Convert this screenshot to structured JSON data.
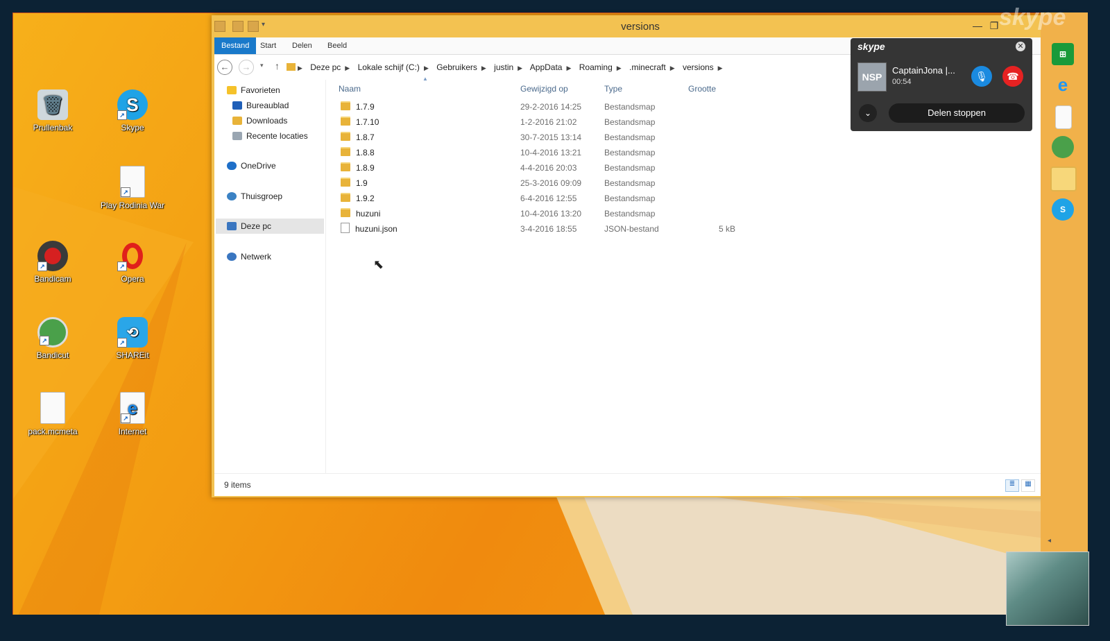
{
  "desktop": {
    "icons": [
      {
        "label": "Prullenbak"
      },
      {
        "label": "Skype"
      },
      {
        "label": "Play Rodinia War"
      },
      {
        "label": "Bandicam"
      },
      {
        "label": "Opera"
      },
      {
        "label": "Bandicut"
      },
      {
        "label": "SHAREit"
      },
      {
        "label": "pack.mcmeta"
      },
      {
        "label": "Internet"
      }
    ]
  },
  "explorer": {
    "title": "versions",
    "ribbon_tabs": [
      "Bestand",
      "Start",
      "Delen",
      "Beeld"
    ],
    "breadcrumb": [
      "Deze pc",
      "Lokale schijf (C:)",
      "Gebruikers",
      "justin",
      "AppData",
      "Roaming",
      ".minecraft",
      "versions"
    ],
    "nav": {
      "favorites": "Favorieten",
      "desktop": "Bureaublad",
      "downloads": "Downloads",
      "recent": "Recente locaties",
      "onedrive": "OneDrive",
      "homegroup": "Thuisgroep",
      "thispc": "Deze pc",
      "network": "Netwerk"
    },
    "columns": {
      "name": "Naam",
      "modified": "Gewijzigd op",
      "type": "Type",
      "size": "Grootte"
    },
    "files": [
      {
        "name": "1.7.9",
        "modified": "29-2-2016 14:25",
        "type": "Bestandsmap",
        "size": ""
      },
      {
        "name": "1.7.10",
        "modified": "1-2-2016 21:02",
        "type": "Bestandsmap",
        "size": ""
      },
      {
        "name": "1.8.7",
        "modified": "30-7-2015 13:14",
        "type": "Bestandsmap",
        "size": ""
      },
      {
        "name": "1.8.8",
        "modified": "10-4-2016 13:21",
        "type": "Bestandsmap",
        "size": ""
      },
      {
        "name": "1.8.9",
        "modified": "4-4-2016 20:03",
        "type": "Bestandsmap",
        "size": ""
      },
      {
        "name": "1.9",
        "modified": "25-3-2016 09:09",
        "type": "Bestandsmap",
        "size": ""
      },
      {
        "name": "1.9.2",
        "modified": "6-4-2016 12:55",
        "type": "Bestandsmap",
        "size": ""
      },
      {
        "name": "huzuni",
        "modified": "10-4-2016 13:20",
        "type": "Bestandsmap",
        "size": ""
      },
      {
        "name": "huzuni.json",
        "modified": "3-4-2016 18:55",
        "type": "JSON-bestand",
        "size": "5 kB"
      }
    ],
    "status": "9 items"
  },
  "skype": {
    "logo": "skype",
    "watermark": "skype",
    "caller": "CaptainJona |...",
    "duration": "00:54",
    "avatar_text": "NSP",
    "share_button": "Delen stoppen"
  },
  "colors": {
    "accent": "#1979ca",
    "desktop": "#f39d12",
    "window_frame": "#f3c251"
  }
}
